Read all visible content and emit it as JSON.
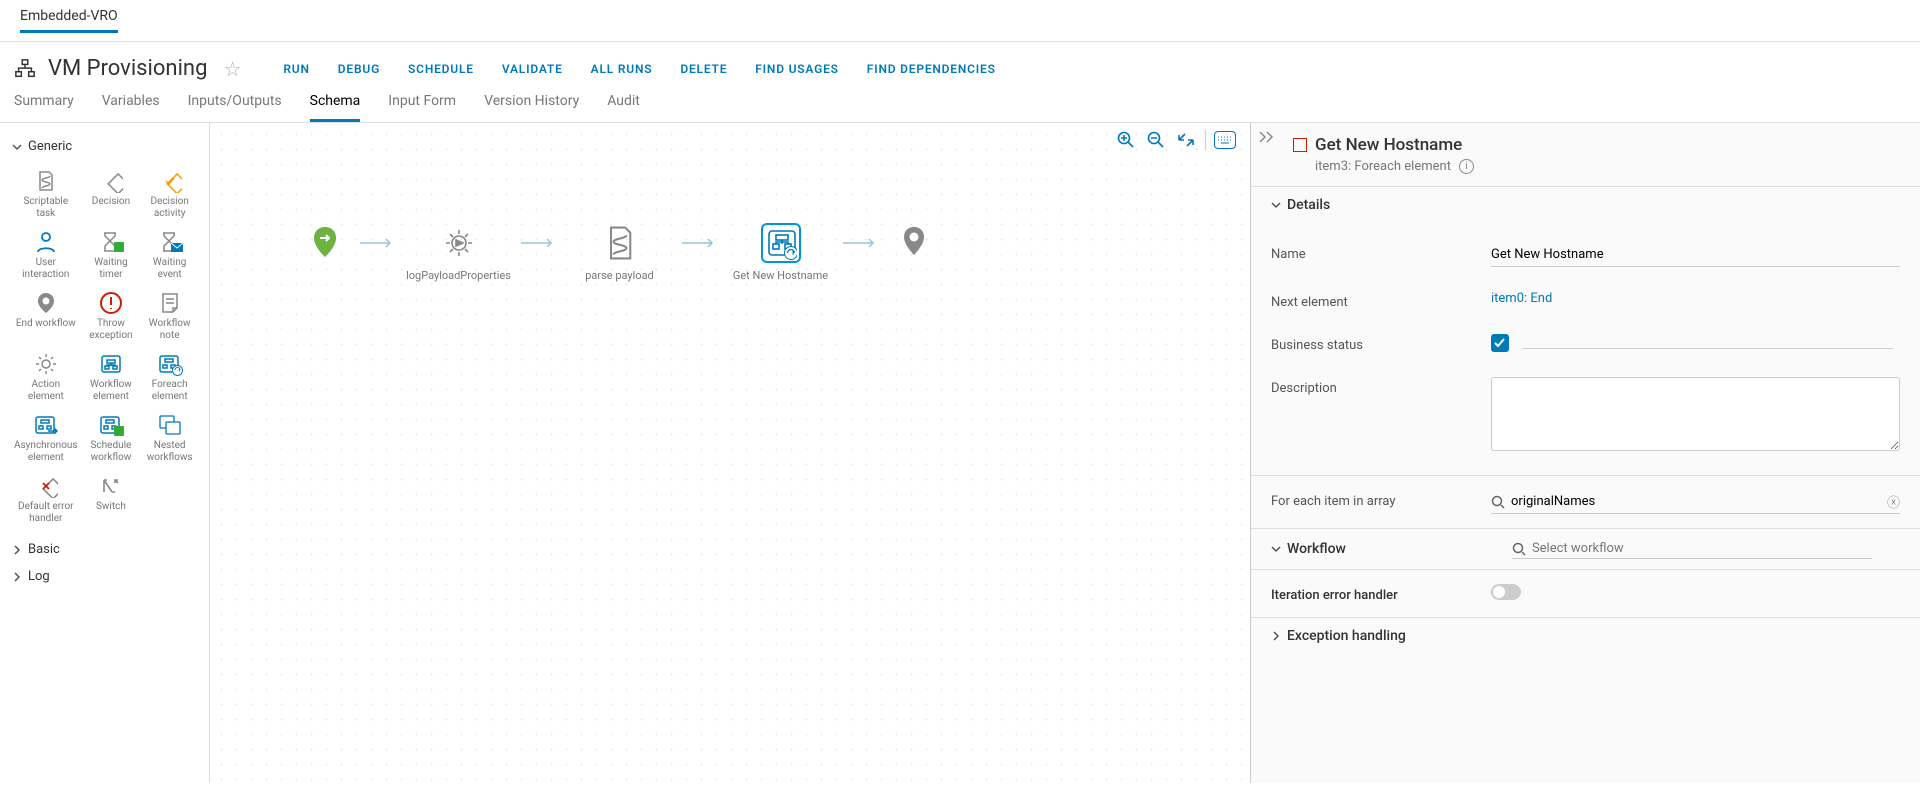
{
  "topTab": "Embedded-VRO",
  "workflowTitle": "VM Provisioning",
  "actions": [
    "RUN",
    "DEBUG",
    "SCHEDULE",
    "VALIDATE",
    "ALL RUNS",
    "DELETE",
    "FIND USAGES",
    "FIND DEPENDENCIES"
  ],
  "subtabs": [
    "Summary",
    "Variables",
    "Inputs/Outputs",
    "Schema",
    "Input Form",
    "Version History",
    "Audit"
  ],
  "activeSubtab": "Schema",
  "palette": {
    "sections": [
      {
        "title": "Generic",
        "open": true,
        "items": [
          {
            "label": "Scriptable task"
          },
          {
            "label": "Decision"
          },
          {
            "label": "Decision activity"
          },
          {
            "label": "User interaction"
          },
          {
            "label": "Waiting timer"
          },
          {
            "label": "Waiting event"
          },
          {
            "label": "End workflow"
          },
          {
            "label": "Throw exception"
          },
          {
            "label": "Workflow note"
          },
          {
            "label": "Action element"
          },
          {
            "label": "Workflow element"
          },
          {
            "label": "Foreach element"
          },
          {
            "label": "Asynchronous element"
          },
          {
            "label": "Schedule workflow"
          },
          {
            "label": "Nested workflows"
          },
          {
            "label": "Default error handler"
          },
          {
            "label": "Switch"
          }
        ]
      },
      {
        "title": "Basic",
        "open": false
      },
      {
        "title": "Log",
        "open": false
      }
    ]
  },
  "flow": {
    "nodes": [
      {
        "label": ""
      },
      {
        "label": "logPayloadProperties"
      },
      {
        "label": "parse payload"
      },
      {
        "label": "Get New Hostname"
      },
      {
        "label": ""
      }
    ]
  },
  "details": {
    "title": "Get New Hostname",
    "subtitle": "item3: Foreach element",
    "sections": {
      "detailsLabel": "Details",
      "name": {
        "label": "Name",
        "value": "Get New Hostname"
      },
      "next": {
        "label": "Next element",
        "value": "item0: End"
      },
      "business": {
        "label": "Business status"
      },
      "description": {
        "label": "Description"
      },
      "foreach": {
        "label": "For each item in array",
        "value": "originalNames"
      },
      "workflow": {
        "label": "Workflow",
        "placeholder": "Select workflow"
      },
      "iter": {
        "label": "Iteration error handler"
      },
      "exception": {
        "label": "Exception handling"
      }
    }
  }
}
